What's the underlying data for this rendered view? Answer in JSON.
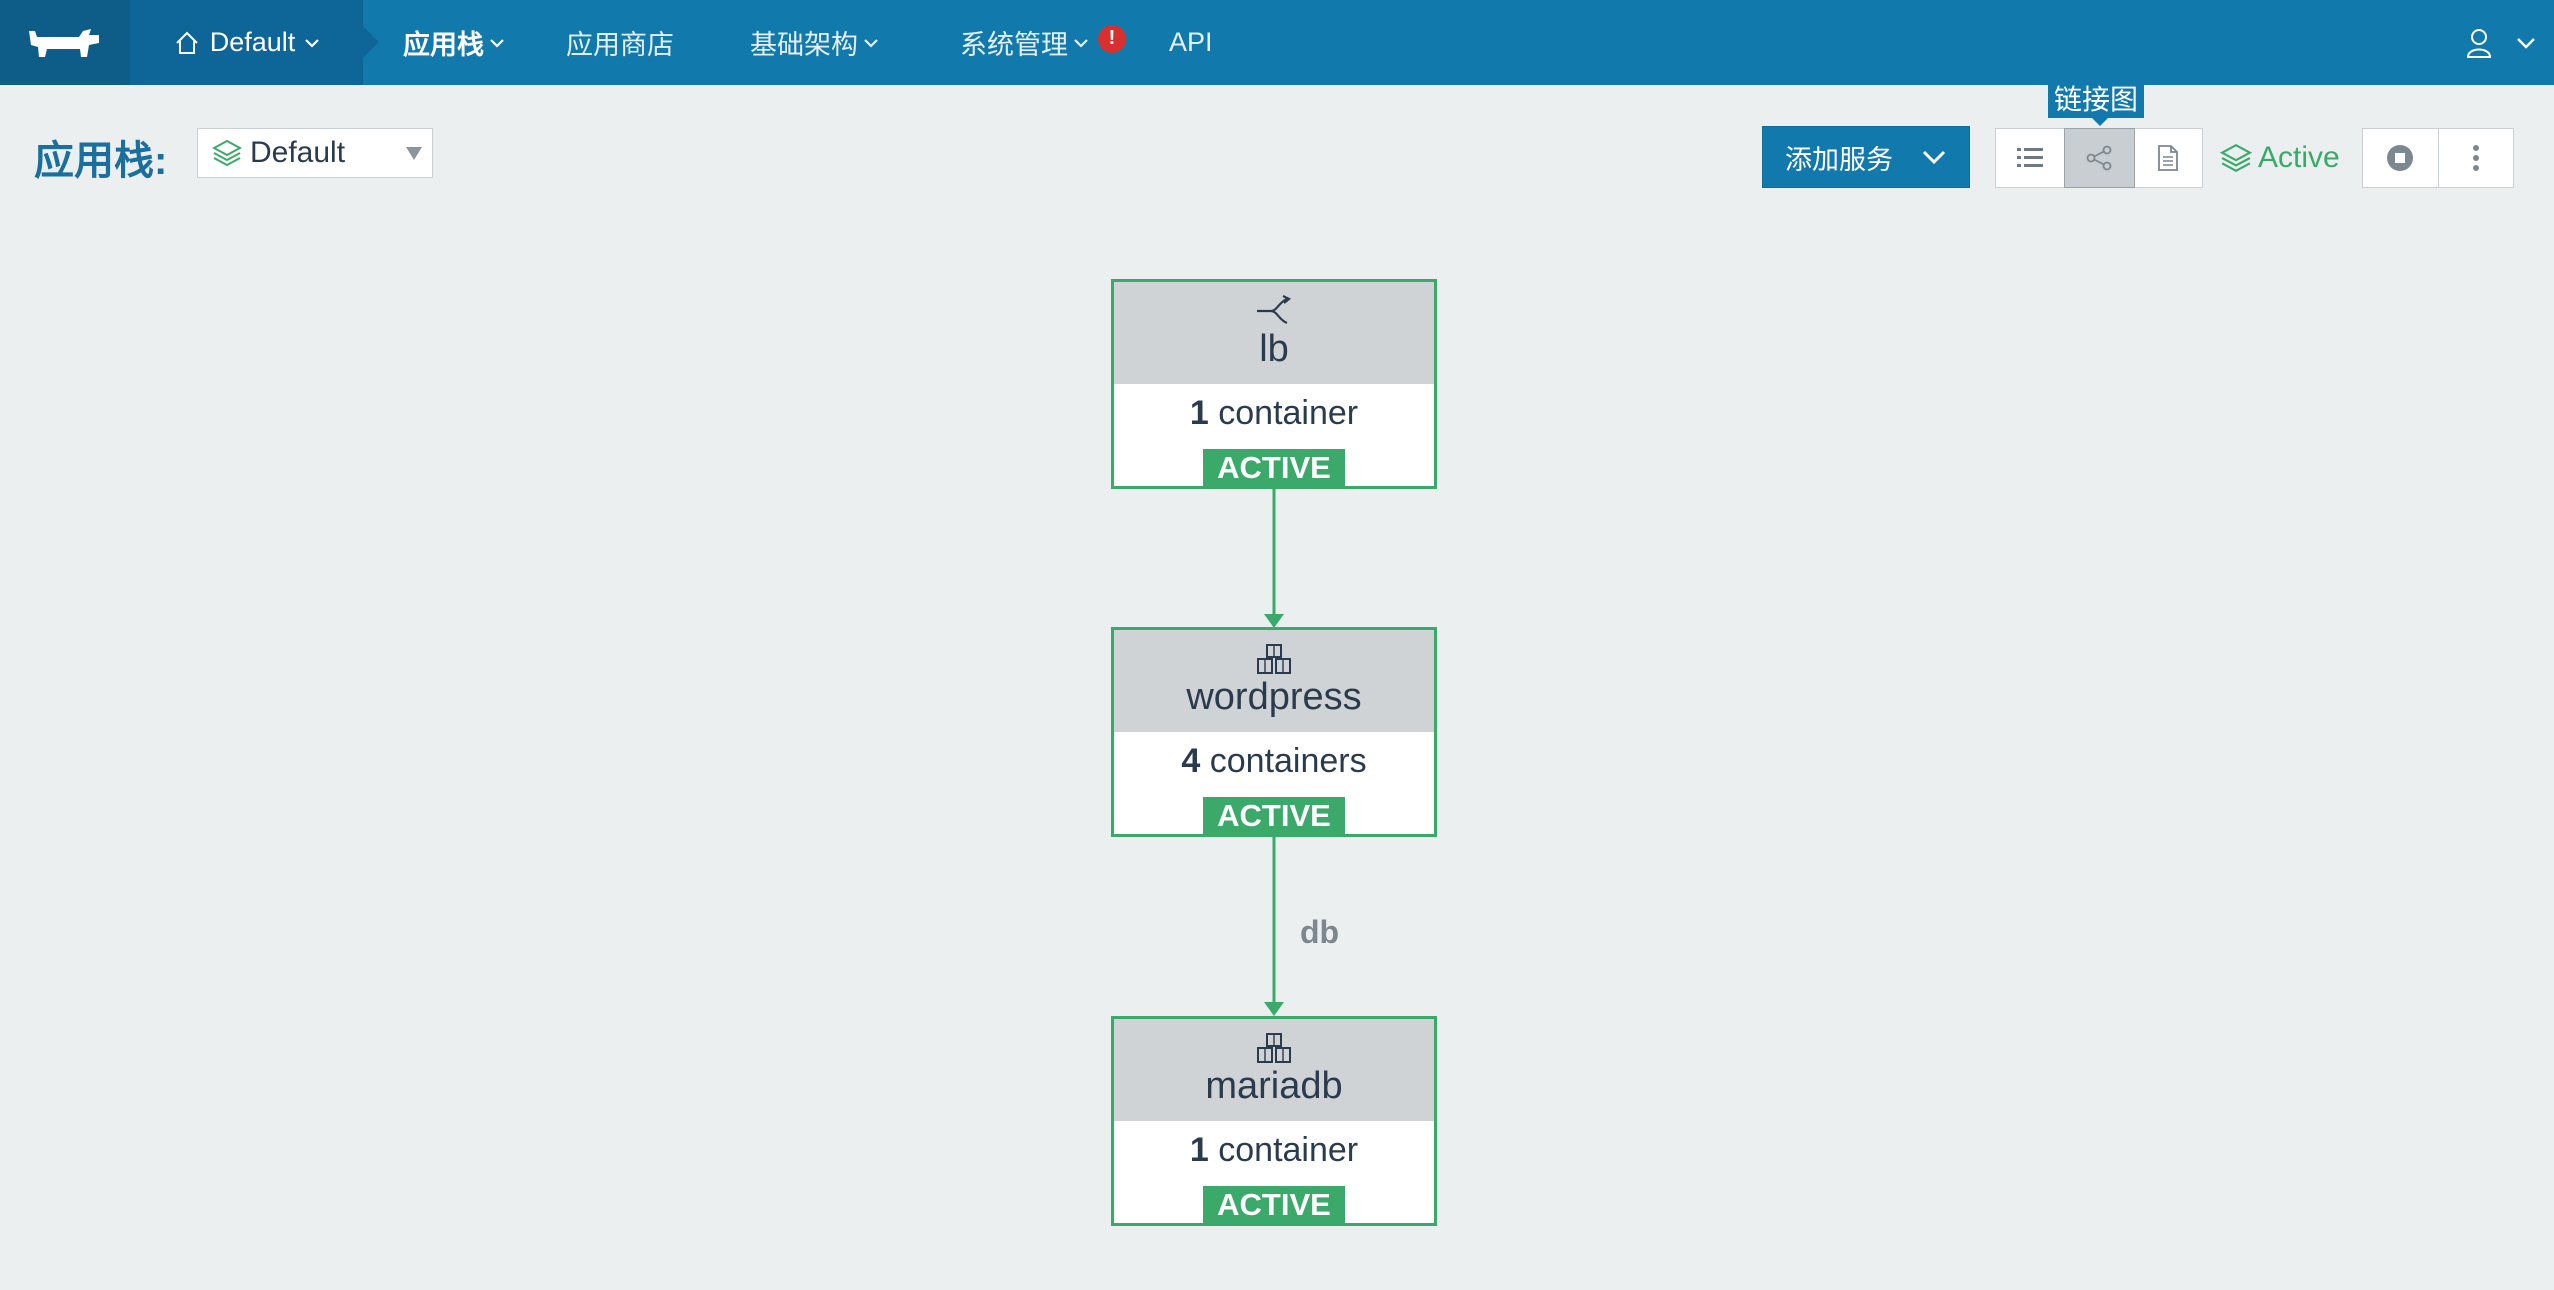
{
  "nav": {
    "environment": "Default",
    "items": [
      {
        "label": "应用栈",
        "active": true,
        "dropdown": true
      },
      {
        "label": "应用商店",
        "active": false,
        "dropdown": false
      },
      {
        "label": "基础架构",
        "active": false,
        "dropdown": true
      },
      {
        "label": "系统管理",
        "active": false,
        "dropdown": true,
        "alert": "!"
      },
      {
        "label": "API",
        "active": false,
        "dropdown": false
      }
    ]
  },
  "header": {
    "title": "应用栈:",
    "stack_selected": "Default",
    "add_service_label": "添加服务",
    "tooltip": "链接图",
    "state": "Active"
  },
  "graph": {
    "nodes": [
      {
        "name": "lb",
        "icon": "load-balancer-icon",
        "count": "1",
        "count_label": "container",
        "status": "ACTIVE"
      },
      {
        "name": "wordpress",
        "icon": "service-cubes-icon",
        "count": "4",
        "count_label": "containers",
        "status": "ACTIVE"
      },
      {
        "name": "mariadb",
        "icon": "service-cubes-icon",
        "count": "1",
        "count_label": "container",
        "status": "ACTIVE"
      }
    ],
    "edges": [
      {
        "from": "lb",
        "to": "wordpress",
        "label": ""
      },
      {
        "from": "wordpress",
        "to": "mariadb",
        "label": "db"
      }
    ]
  },
  "colors": {
    "nav": "#1279ad",
    "active_green": "#3aa96a",
    "background": "#ebeff0"
  }
}
